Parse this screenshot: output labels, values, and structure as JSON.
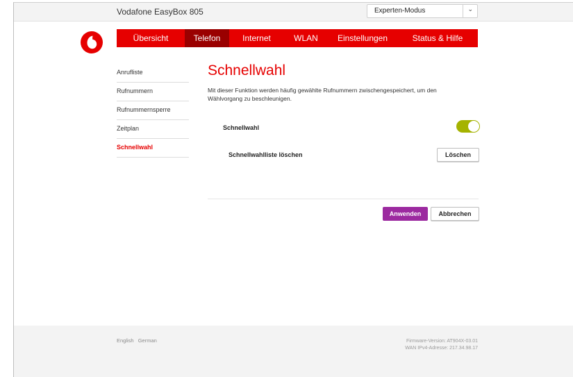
{
  "header": {
    "title": "Vodafone EasyBox 805",
    "mode_select": {
      "value": "Experten-Modus",
      "chevron": "chevron-down-icon"
    }
  },
  "brand": {
    "logo": "vodafone-logo",
    "color": "#e60000"
  },
  "nav": {
    "items": [
      {
        "label": "Übersicht"
      },
      {
        "label": "Telefon"
      },
      {
        "label": "Internet"
      },
      {
        "label": "WLAN"
      },
      {
        "label": "Einstellungen"
      },
      {
        "label": "Status & Hilfe"
      }
    ],
    "active": "Telefon"
  },
  "sidebar": {
    "items": [
      {
        "label": "Anrufliste"
      },
      {
        "label": "Rufnummern"
      },
      {
        "label": "Rufnummernsperre"
      },
      {
        "label": "Zeitplan"
      },
      {
        "label": "Schnellwahl"
      }
    ],
    "active": "Schnellwahl"
  },
  "main": {
    "title": "Schnellwahl",
    "description": "Mit dieser Funktion werden häufig gewählte Rufnummern zwischengespeichert, um den Wählvorgang zu beschleunigen.",
    "toggle": {
      "label": "Schnellwahl",
      "state": "on",
      "color": "#a5b300"
    },
    "clear_row": {
      "label": "Schnellwahlliste löschen",
      "button": "Löschen"
    },
    "apply_button": "Anwenden",
    "cancel_button": "Abbrechen",
    "apply_color": "#9c2aa0"
  },
  "footer": {
    "languages": [
      "English",
      "German"
    ],
    "firmware": "Firmware-Version: AT904X-03.01",
    "wan": "WAN IPv4-Adresse: 217.34.98.17"
  }
}
